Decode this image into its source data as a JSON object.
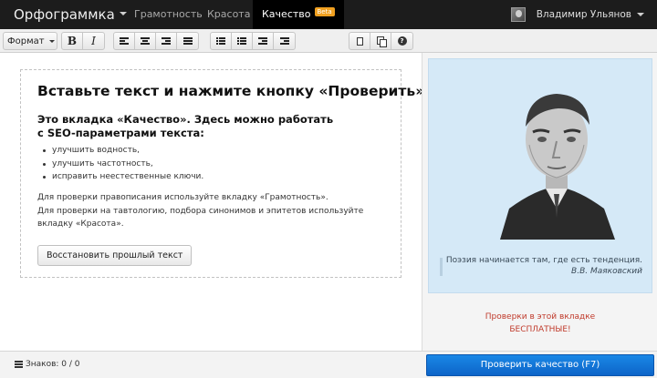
{
  "nav": {
    "brand": "Орфограммка",
    "tabs": [
      {
        "label": "Грамотность"
      },
      {
        "label": "Красота"
      },
      {
        "label": "Качество",
        "badge": "Beta"
      }
    ],
    "user_name": "Владимир Ульянов"
  },
  "toolbar": {
    "format_label": "Формат",
    "bold": "B",
    "italic": "I",
    "help": "?"
  },
  "editor": {
    "title": "Вставьте текст и нажмите кнопку «Проверить»",
    "subtitle": "Это вкладка «Качество». Здесь можно работать с SEO-параметрами текста:",
    "bullets": [
      "улучшить водность,",
      "улучшить частотность,",
      "исправить неестественные ключи."
    ],
    "para_line1": "Для проверки правописания используйте вкладку «Грамотность».",
    "para_line2": "Для проверки на тавтологию, подбора синонимов и эпитетов используйте вкладку «Красота».",
    "restore_label": "Восстановить прошлый текст"
  },
  "side": {
    "quote_text": "Поэзия начинается там, где есть тенденция.",
    "quote_author": "В.В. Маяковский",
    "free_line1": "Проверки в этой вкладке",
    "free_line2": "БЕСПЛАТНЫЕ!"
  },
  "footer": {
    "counter_label": "Знаков: 0 / 0",
    "check_label": "Проверить качество (F7)"
  },
  "colors": {
    "topbar": "#1c1c1c",
    "beta_badge": "#f0a020",
    "quote_bg": "#d5e9f7",
    "free_text": "#c03a2b",
    "primary_button": "#1a7fe0"
  }
}
